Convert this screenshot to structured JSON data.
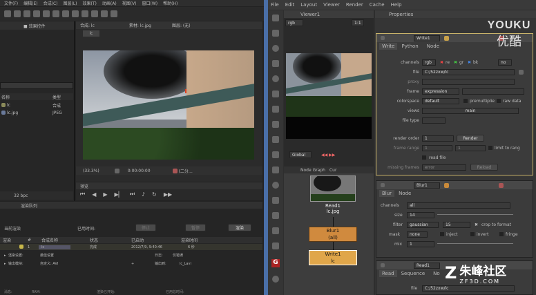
{
  "ae": {
    "menu": [
      "文件(F)",
      "编辑(E)",
      "合成(C)",
      "图层(L)",
      "效果(T)",
      "动画(A)",
      "视图(V)",
      "窗口(W)",
      "帮助(H)"
    ],
    "left_tabs": "■ 效果控件",
    "comp_tab": "合成: lc",
    "footage_tab": "素材: lc.jpg",
    "layer_tab": "图层: (无)",
    "comp_name": "lc",
    "project_cols": {
      "name": "名称",
      "type": "类型"
    },
    "project_items": [
      {
        "name": "lc",
        "type": "合成"
      },
      {
        "name": "lc.jpg",
        "type": "JPEG"
      }
    ],
    "bpc": "32 bpc",
    "zoom": "(33.3%)",
    "timecode": "0:00:00:00",
    "view_mode": "(二分…",
    "preview_label": "预览",
    "render_queue_tab": "渲染队列",
    "current_render": "当前渲染",
    "elapsed_label": "已用时间:",
    "stop_btn": "停止",
    "pause_btn": "暂停",
    "render_btn": "渲染",
    "queue_cols": [
      "渲染",
      "#",
      "合成名称",
      "状态",
      "已启动",
      "渲染时间"
    ],
    "queue_row": {
      "num": "1",
      "name": "lc",
      "status": "完成",
      "started": "2012/7/9, 9:40:46",
      "time": "6 秒"
    },
    "render_settings_label": "渲染设置:",
    "render_settings_value": "最佳设置",
    "output_module_label": "输出模块:",
    "output_module_value": "自定义: AVI",
    "log_label": "日志:",
    "log_value": "仅错误",
    "output_to_label": "输出到:",
    "output_to_value": "lc_Lavi",
    "bottom_labels": [
      "消息:",
      "RAM:",
      "渲染已开始:",
      "已用总时间:"
    ]
  },
  "nuke": {
    "menu": [
      "File",
      "Edit",
      "Layout",
      "Viewer",
      "Render",
      "Cache",
      "Help"
    ],
    "viewer_tab": "Viewer1",
    "properties_tab": "Properties",
    "viewer_channel": "rgb",
    "viewer_zoom": "1:1",
    "global_label": "Global",
    "node_graph_tab": "Node Graph",
    "curve_tab": "Cur",
    "nodes": [
      {
        "name": "Read1",
        "sub": "lc.jpg"
      },
      {
        "name": "Blur1",
        "sub": "(all)"
      },
      {
        "name": "Write1",
        "sub": "lc"
      }
    ],
    "write": {
      "title": "Write1",
      "tabs": [
        "Write",
        "Python",
        "Node"
      ],
      "channels_label": "channels",
      "channels_value": "rgb",
      "channels_checks": [
        "re",
        "gr",
        "bk"
      ],
      "channels_none": "no",
      "file_label": "file",
      "file_value": "C:/52zxw/lc",
      "proxy_label": "proxy",
      "frame_label": "frame",
      "frame_value": "expression",
      "colorspace_label": "colorspace",
      "colorspace_value": "default",
      "premultiplied": "premultiplie",
      "raw_data": "raw data",
      "views_label": "views",
      "views_value": "main",
      "filetype_label": "file type",
      "render_order_label": "render order",
      "render_order_value": "1",
      "render_btn": "Render",
      "frame_range_label": "frame range",
      "frame_range_a": "1",
      "frame_range_b": "1",
      "limit_label": "limit to rang",
      "read_file": "read file",
      "missing_frames_label": "missing frames",
      "missing_frames_value": "error",
      "reload_btn": "Reload"
    },
    "blur": {
      "title": "Blur1",
      "tabs": [
        "Blur",
        "Node"
      ],
      "channels_label": "channels",
      "channels_value": "all",
      "size_label": "size",
      "size_value": "14",
      "filter_label": "filter",
      "filter_value": "gaussian",
      "filter_num": "15",
      "crop_label": "crop to format",
      "mask_label": "mask",
      "mask_value": "none",
      "inject": "inject",
      "invert": "invert",
      "fringe": "fringe",
      "mix_label": "mix",
      "mix_value": "1"
    },
    "read": {
      "title": "Read1",
      "tabs": [
        "Read",
        "Sequence",
        "No"
      ],
      "file_label": "file",
      "file_value": "C:/52zxw/lc"
    }
  },
  "watermarks": {
    "youku_latin": "YOUKU",
    "youku_cn": "优酷",
    "zf3d_cn": "朱峰社区",
    "zf3d_url": "ZF3D.COM"
  }
}
